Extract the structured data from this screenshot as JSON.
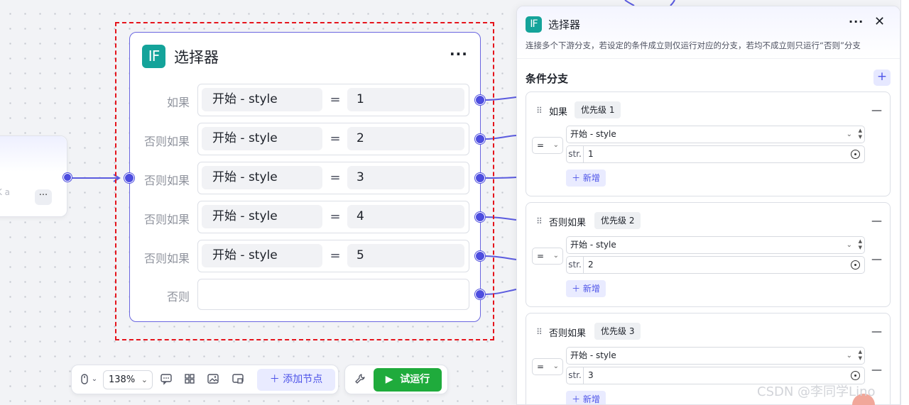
{
  "left_node": {
    "more_label": "···",
    "subtext": "K a"
  },
  "selector_node": {
    "badge": "IF",
    "title": "选择器",
    "more_label": "···",
    "rows": [
      {
        "label": "如果",
        "var_text": "开始  -  style",
        "op": "=",
        "value": "1"
      },
      {
        "label": "否则如果",
        "var_text": "开始  -  style",
        "op": "=",
        "value": "2"
      },
      {
        "label": "否则如果",
        "var_text": "开始  -  style",
        "op": "=",
        "value": "3"
      },
      {
        "label": "否则如果",
        "var_text": "开始  -  style",
        "op": "=",
        "value": "4"
      },
      {
        "label": "否则如果",
        "var_text": "开始  -  style",
        "op": "=",
        "value": "5"
      }
    ],
    "else_label": "否则"
  },
  "toolbar": {
    "zoom": "138%",
    "add_node": "添加节点",
    "add_node_icon": "plus-icon",
    "run": "试运行",
    "run_icon": "play-icon"
  },
  "panel": {
    "badge": "IF",
    "title": "选择器",
    "more_label": "···",
    "close_label": "✕",
    "description": "连接多个下游分支，若设定的条件成立则仅运行对应的分支，若均不成立则只运行“否则”分支",
    "section_title": "条件分支",
    "add_label": "+",
    "branches": [
      {
        "label": "如果",
        "priority": "优先级 1",
        "op": "=",
        "var_text": "开始 - style",
        "type": "str.",
        "value": "1",
        "new_label": "新增"
      },
      {
        "label": "否则如果",
        "priority": "优先级 2",
        "op": "=",
        "var_text": "开始 - style",
        "type": "str.",
        "value": "2",
        "new_label": "新增"
      },
      {
        "label": "否则如果",
        "priority": "优先级 3",
        "op": "=",
        "var_text": "开始 - style",
        "type": "str.",
        "value": "3",
        "new_label": "新增"
      }
    ]
  },
  "watermark": "CSDN @李同学Lino",
  "colors": {
    "accent": "#4d4ddf",
    "badge": "#14a39a",
    "selection": "#e5141c",
    "run": "#1fab3c"
  }
}
